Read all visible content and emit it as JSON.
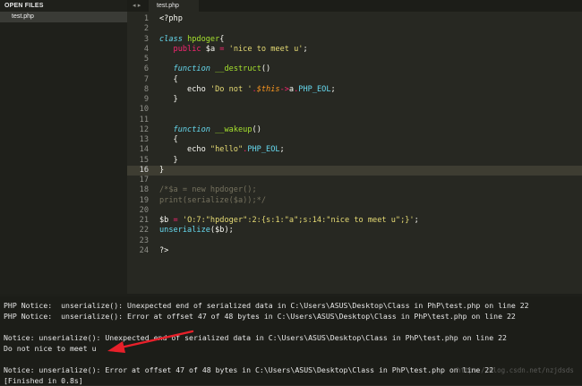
{
  "sidebar": {
    "header": "OPEN FILES",
    "files": [
      "test.php"
    ]
  },
  "tabbar": {
    "nav": "◂ ▸",
    "active_tab": "test.php"
  },
  "editor": {
    "active_line": 16,
    "line_numbers": [
      "1",
      "2",
      "3",
      "4",
      "5",
      "6",
      "7",
      "8",
      "9",
      "10",
      "11",
      "12",
      "13",
      "14",
      "15",
      "16",
      "17",
      "18",
      "19",
      "20",
      "21",
      "22",
      "23",
      "24"
    ],
    "code": {
      "l1_open": "<?php",
      "l3_class_kw": "class",
      "l3_name": "hpdoger",
      "l3_brace": "{",
      "l4_public": "public",
      "l4_var": "$a",
      "l4_eq": " = ",
      "l4_str": "'nice to meet u'",
      "l4_semi": ";",
      "l6_func": "function",
      "l6_name": "__destruct",
      "l6_paren": "()",
      "l7_brace": "{",
      "l8_echo": "echo ",
      "l8_str": "'Do not '",
      "l8_dot1": ".",
      "l8_this": "$this",
      "l8_arrow": "->",
      "l8_prop": "a",
      "l8_dot2": ".",
      "l8_eol": "PHP_EOL",
      "l8_semi": ";",
      "l9_brace": "}",
      "l12_func": "function",
      "l12_name": "__wakeup",
      "l12_paren": "()",
      "l13_brace": "{",
      "l14_echo": "echo ",
      "l14_str": "\"hello\"",
      "l14_dot": ".",
      "l14_eol": "PHP_EOL",
      "l14_semi": ";",
      "l15_brace": "}",
      "l16_brace": "}",
      "l18_comment": "/*$a = new hpdoger();",
      "l19_comment": "print(serialize($a));*/",
      "l21_var": "$b",
      "l21_eq": " = ",
      "l21_str": "'O:7:\"hpdoger\":2:{s:1:\"a\";s:14:\"nice to meet u\";}'",
      "l21_semi": ";",
      "l22_fn": "unserialize",
      "l22_args": "($b);",
      "l24_close": "?>"
    }
  },
  "output": {
    "lines": [
      "PHP Notice:  unserialize(): Unexpected end of serialized data in C:\\Users\\ASUS\\Desktop\\Class in PhP\\test.php on line 22",
      "PHP Notice:  unserialize(): Error at offset 47 of 48 bytes in C:\\Users\\ASUS\\Desktop\\Class in PhP\\test.php on line 22",
      "",
      "Notice: unserialize(): Unexpected end of serialized data in C:\\Users\\ASUS\\Desktop\\Class in PhP\\test.php on line 22",
      "Do not nice to meet u",
      "",
      "Notice: unserialize(): Error at offset 47 of 48 bytes in C:\\Users\\ASUS\\Desktop\\Class in PhP\\test.php on line 22",
      "[Finished in 0.8s]"
    ],
    "watermark": "https://blog.csdn.net/nzjdsds"
  },
  "colors": {
    "annotation_arrow": "#e8202a"
  }
}
